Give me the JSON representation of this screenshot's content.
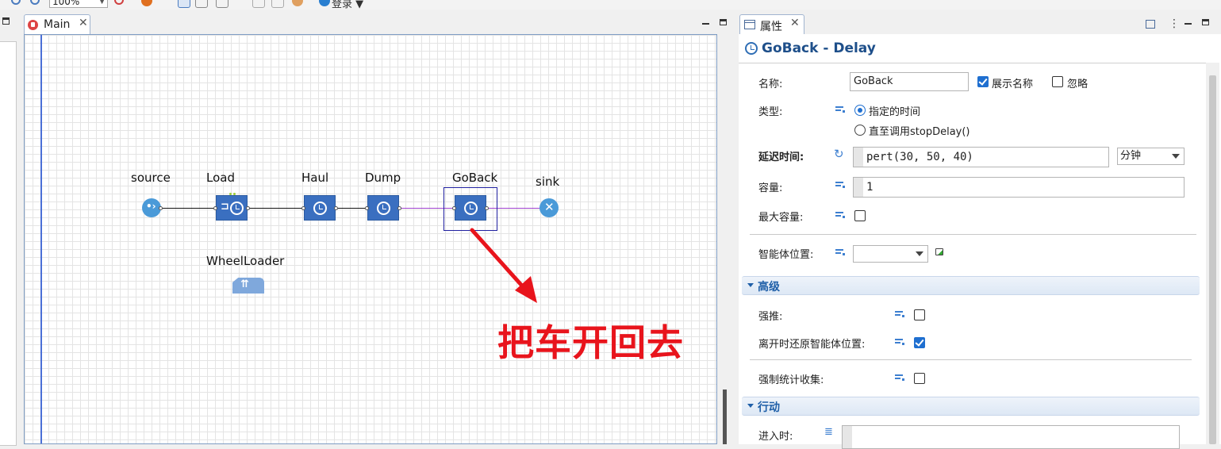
{
  "toolbar": {
    "zoom_value": "100%",
    "login_label": "登录"
  },
  "editor": {
    "tab_label": "Main",
    "nodes": {
      "source": "source",
      "load": "Load",
      "haul": "Haul",
      "dump": "Dump",
      "goback": "GoBack",
      "sink": "sink",
      "resource": "WheelLoader"
    },
    "annotation": "把车开回去",
    "colors": {
      "block_blue": "#3a6fc0",
      "connector_purple": "#a040d0",
      "selection": "#2020a0",
      "annotation_red": "#e8141c"
    }
  },
  "properties": {
    "tab_label": "属性",
    "title": "GoBack - Delay",
    "name_label": "名称:",
    "name_value": "GoBack",
    "show_name_label": "展示名称",
    "show_name_checked": true,
    "ignore_label": "忽略",
    "ignore_checked": false,
    "type_label": "类型:",
    "type_option1": "指定的时间",
    "type_option2": "直至调用stopDelay()",
    "type_selected": "指定的时间",
    "delay_label": "延迟时间:",
    "delay_value": "pert(30, 50, 40)",
    "delay_unit": "分钟",
    "capacity_label": "容量:",
    "capacity_value": "1",
    "max_capacity_label": "最大容量:",
    "max_capacity_checked": false,
    "agent_location_label": "智能体位置:",
    "agent_location_value": "",
    "advanced_section": "高级",
    "push_label": "强推:",
    "push_checked": false,
    "restore_label": "离开时还原智能体位置:",
    "restore_checked": true,
    "force_stats_label": "强制统计收集:",
    "force_stats_checked": false,
    "actions_section": "行动",
    "on_enter_label": "进入时:"
  }
}
